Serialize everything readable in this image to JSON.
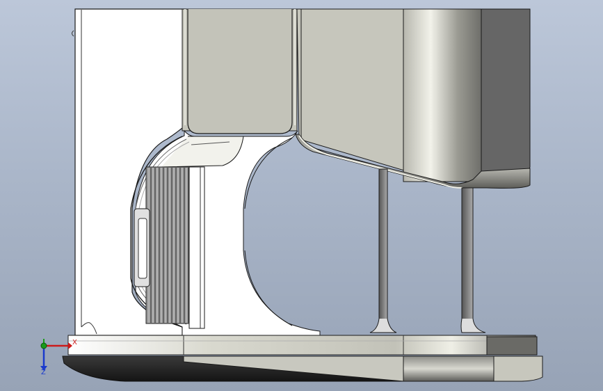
{
  "triad": {
    "x_label": "X",
    "z_label": "Z"
  },
  "colors": {
    "background_top": "#bcc7d9",
    "background_bottom": "#97a3b6",
    "white_body": "#ffffff",
    "gray_panel": "#c6c6bc",
    "dark_panel": "#666666",
    "base_shadow": "#242424",
    "axis_x": "#cc1a1a",
    "axis_y": "#1a9a1a",
    "axis_z": "#1a3acc"
  },
  "icons": [
    "coordinate-triad-icon"
  ]
}
